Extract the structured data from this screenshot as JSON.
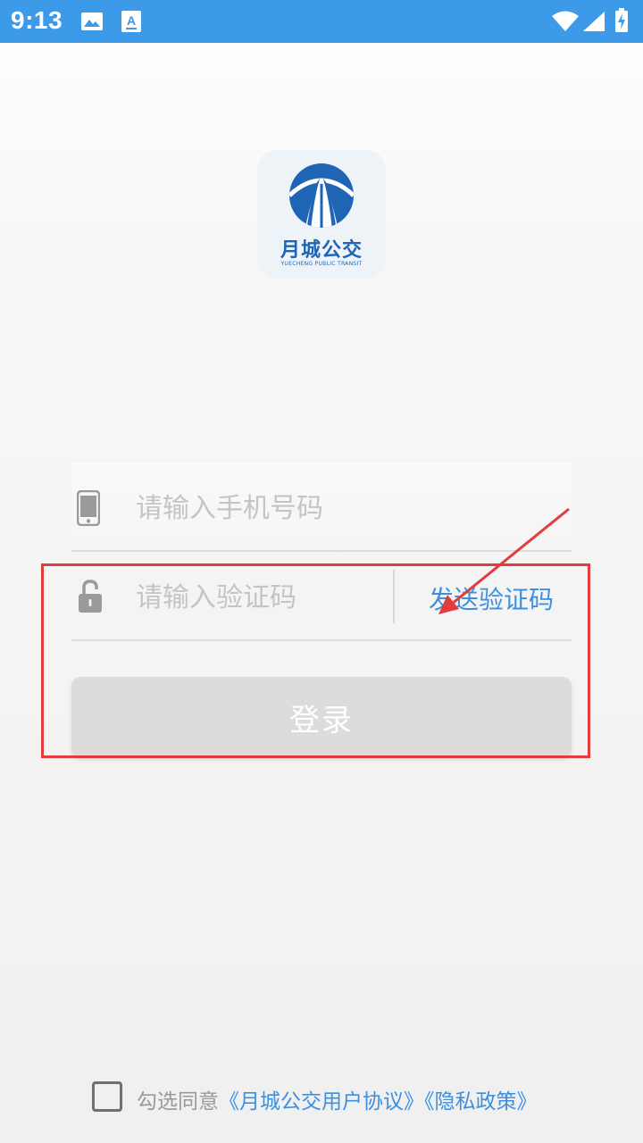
{
  "status_bar": {
    "time": "9:13",
    "icons": [
      "image-icon",
      "text-a-icon",
      "wifi-icon",
      "cell-signal-icon",
      "battery-charging-icon"
    ],
    "background": "#3d9ae8"
  },
  "logo": {
    "name": "月城公交",
    "subtitle": "YUECHENG PUBLIC TRANSIT",
    "color": "#1f64b5"
  },
  "form": {
    "phone_placeholder": "请输入手机号码",
    "code_placeholder": "请输入验证码",
    "send_code_label": "发送验证码",
    "login_label": "登录"
  },
  "agreement": {
    "prefix": "勾选同意",
    "user_agreement": "《月城公交用户协议》",
    "privacy_policy": "《隐私政策》",
    "checked": false
  },
  "colors": {
    "accent": "#3d8fe0",
    "annotation": "#e23c3c"
  }
}
